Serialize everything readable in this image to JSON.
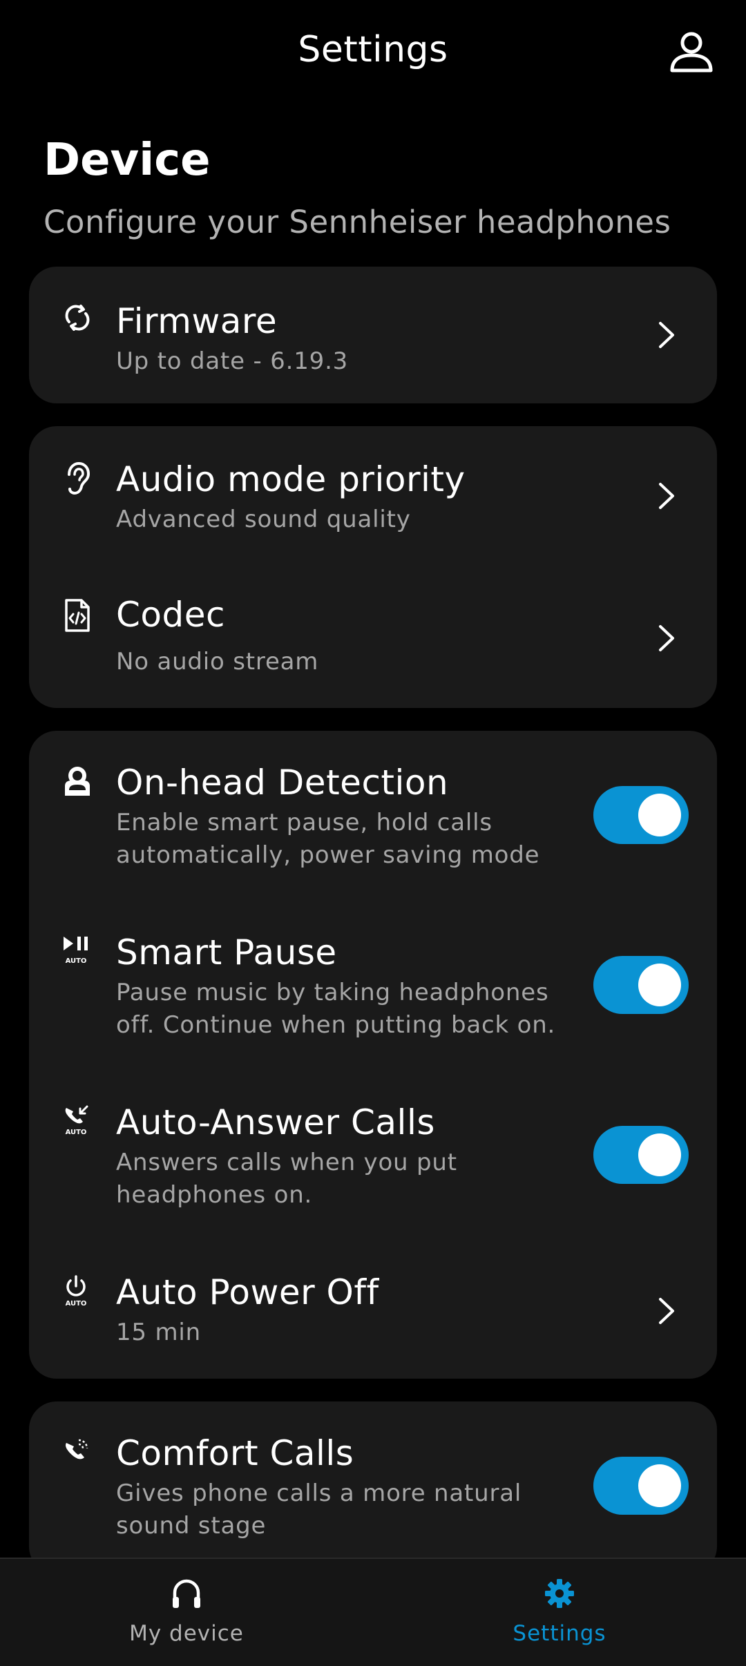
{
  "header": {
    "title": "Settings",
    "profile_icon": "person-outline-icon"
  },
  "section": {
    "title": "Device",
    "subtitle": "Configure your Sennheiser headphones"
  },
  "cards": {
    "firmware": {
      "icon": "refresh-icon",
      "title": "Firmware",
      "subtitle": "Up to date - 6.19.3"
    },
    "audio": {
      "audio_mode": {
        "icon": "ear-icon",
        "title": "Audio mode priority",
        "subtitle": "Advanced sound quality"
      },
      "codec": {
        "icon": "code-file-icon",
        "title": "Codec",
        "subtitle": "No audio stream"
      }
    },
    "controls": {
      "on_head": {
        "icon": "person-badge-icon",
        "title": "On-head Detection",
        "subtitle": "Enable smart pause, hold calls automatically, power saving mode",
        "enabled": true
      },
      "smart_pause": {
        "icon": "play-pause-auto-icon",
        "title": "Smart Pause",
        "subtitle": "Pause music by taking headphones off. Continue when putting back on.",
        "enabled": true
      },
      "auto_answer": {
        "icon": "call-auto-icon",
        "title": "Auto-Answer Calls",
        "subtitle": "Answers calls when you put headphones on.",
        "enabled": true
      },
      "auto_power": {
        "icon": "power-auto-icon",
        "title": "Auto Power Off",
        "subtitle": "15 min"
      }
    },
    "comfort": {
      "comfort_calls": {
        "icon": "phone-waves-icon",
        "title": "Comfort Calls",
        "subtitle": "Gives phone calls a more natural sound stage",
        "enabled": true
      }
    }
  },
  "bottom_nav": {
    "items": [
      {
        "label": "My device",
        "icon": "headphones-icon",
        "active": false
      },
      {
        "label": "Settings",
        "icon": "gear-icon",
        "active": true
      }
    ]
  },
  "colors": {
    "accent": "#0a93d3",
    "background": "#000000",
    "card": "#1a1a1a",
    "secondary_text": "#a6a6a6"
  },
  "icon_small_label": "AUTO"
}
